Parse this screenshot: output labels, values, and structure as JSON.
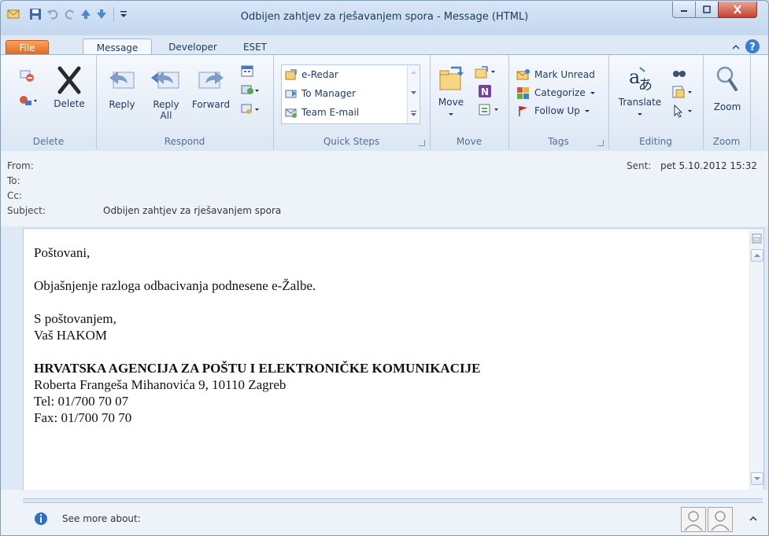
{
  "window": {
    "title": "Odbijen zahtjev za rješavanjem spora - Message (HTML)"
  },
  "tabs": [
    {
      "label": "File"
    },
    {
      "label": "Message"
    },
    {
      "label": "Developer"
    },
    {
      "label": "ESET"
    }
  ],
  "ribbon": {
    "delete": {
      "delete_label": "Delete",
      "group_label": "Delete"
    },
    "respond": {
      "reply_label": "Reply",
      "reply_all_line1": "Reply",
      "reply_all_line2": "All",
      "forward_label": "Forward",
      "group_label": "Respond"
    },
    "quick_steps": {
      "items": [
        "e-Redar",
        "To Manager",
        "Team E-mail"
      ],
      "group_label": "Quick Steps"
    },
    "move": {
      "move_label": "Move",
      "group_label": "Move"
    },
    "tags": {
      "mark_unread": "Mark Unread",
      "categorize": "Categorize",
      "follow_up": "Follow Up",
      "group_label": "Tags"
    },
    "editing": {
      "translate_label": "Translate",
      "group_label": "Editing"
    },
    "zoom": {
      "zoom_label": "Zoom",
      "group_label": "Zoom"
    }
  },
  "header": {
    "from_label": "From:",
    "to_label": "To:",
    "cc_label": "Cc:",
    "subject_label": "Subject:",
    "subject_value": "Odbijen zahtjev za rješavanjem spora",
    "sent_label": "Sent:",
    "sent_value": "pet 5.10.2012 15:32"
  },
  "body": {
    "greeting": "Poštovani,",
    "message": "Objašnjenje razloga odbacivanja podnesene e-Žalbe.",
    "closing": "S poštovanjem,",
    "signature_name": "Vaš HAKOM",
    "org_name": "HRVATSKA AGENCIJA ZA POŠTU I ELEKTRONIČKE KOMUNIKACIJE",
    "address": "Roberta Frangeša Mihanovića 9, 10110 Zagreb",
    "tel": "Tel: 01/700 70 07",
    "fax": "Fax: 01/700 70 70"
  },
  "people_pane": {
    "label": "See more about:"
  },
  "colors": {
    "file_tab": "#e1661b",
    "frame": "#c4d7ef",
    "close_button": "#c7432e"
  }
}
